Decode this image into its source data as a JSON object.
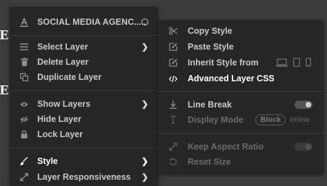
{
  "background": {
    "glyph_1": "E",
    "glyph_2": "E"
  },
  "colors": {
    "menu_bg": "#262626",
    "text": "#c8c8c8",
    "text_dim": "#6b6b6b",
    "text_bright": "#ffffff"
  },
  "context_menu": {
    "header_title": "SOCIAL MEDIA AGENC.....",
    "items": [
      {
        "label": "Select Layer",
        "icon": "layers-icon"
      },
      {
        "label": "Delete Layer",
        "icon": "trash-icon"
      },
      {
        "label": "Duplicate Layer",
        "icon": "duplicate-icon"
      },
      {
        "label": "Show Layers",
        "icon": "eye-icon"
      },
      {
        "label": "Hide Layer",
        "icon": "eye-slash-icon"
      },
      {
        "label": "Lock Layer",
        "icon": "lock-icon"
      },
      {
        "label": "Style",
        "icon": "brush-icon"
      },
      {
        "label": "Layer Responsiveness",
        "icon": "expand-icon"
      }
    ]
  },
  "style_submenu": {
    "items": [
      {
        "label": "Copy Style",
        "icon": "scissors-icon"
      },
      {
        "label": "Paste Style",
        "icon": "edit-icon"
      },
      {
        "label": "Inherit Style from",
        "icon": "edit-icon"
      },
      {
        "label": "Advanced Layer CSS",
        "icon": "code-icon"
      },
      {
        "label": "Line Break",
        "icon": "line-break-icon"
      },
      {
        "label": "Display Mode",
        "icon": "text-cursor-icon",
        "options": [
          "Block",
          "Inline"
        ],
        "selected": "Block"
      },
      {
        "label": "Keep Aspect Ratio",
        "icon": "expand-arrows-icon"
      },
      {
        "label": "Reset Size",
        "icon": "reset-icon"
      }
    ],
    "line_break_on": true,
    "keep_aspect_ratio_on": false
  }
}
